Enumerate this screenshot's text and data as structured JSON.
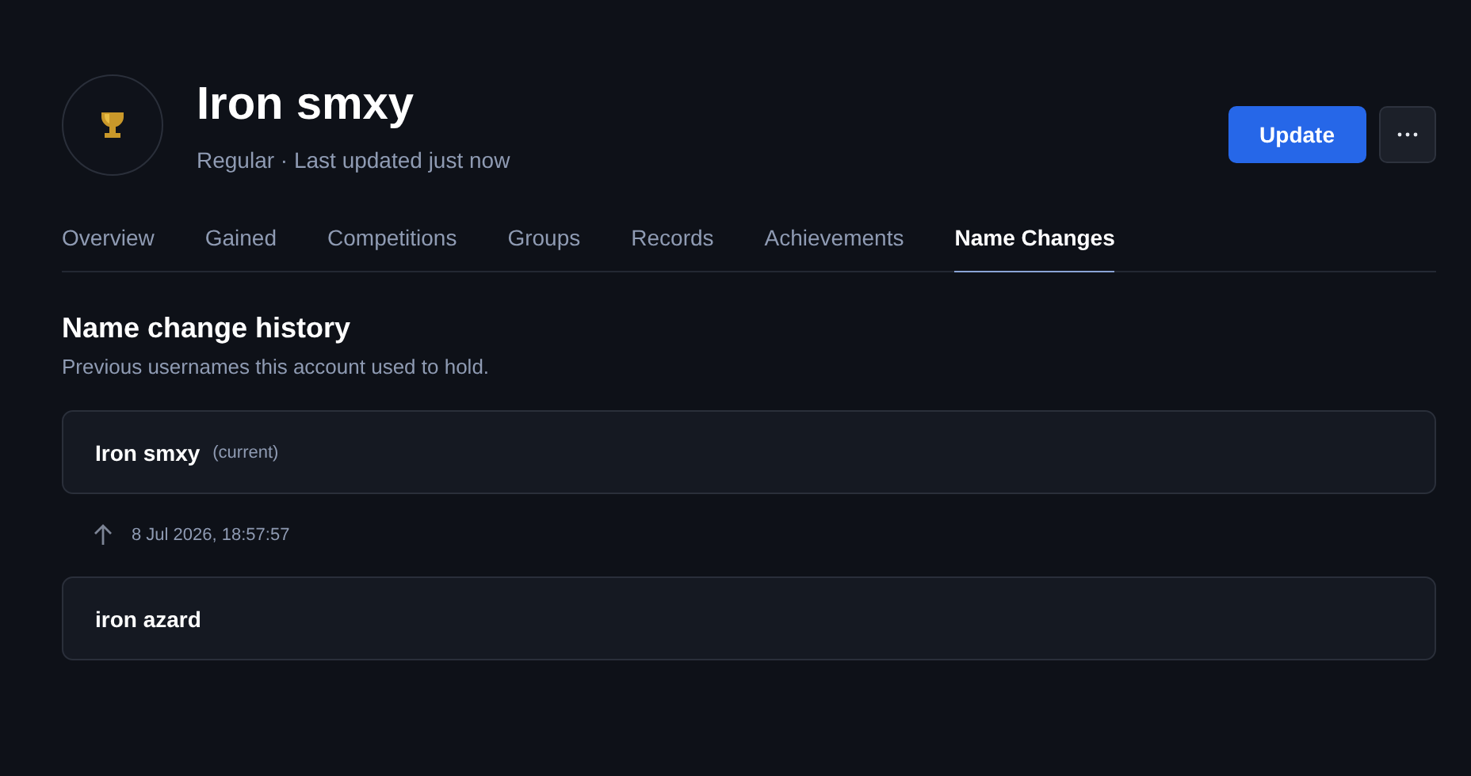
{
  "profile": {
    "name": "Iron smxy",
    "subtitle": "Regular · Last updated just now"
  },
  "actions": {
    "update": "Update"
  },
  "tabs": [
    {
      "label": "Overview",
      "selected": false
    },
    {
      "label": "Gained",
      "selected": false
    },
    {
      "label": "Competitions",
      "selected": false
    },
    {
      "label": "Groups",
      "selected": false
    },
    {
      "label": "Records",
      "selected": false
    },
    {
      "label": "Achievements",
      "selected": false
    },
    {
      "label": "Name Changes",
      "selected": true
    }
  ],
  "section": {
    "title": "Name change history",
    "description": "Previous usernames this account used to hold."
  },
  "history": [
    {
      "kind": "name",
      "name": "Iron smxy",
      "tag": "(current)"
    },
    {
      "kind": "change",
      "date": "8 Jul 2026, 18:57:57"
    },
    {
      "kind": "name",
      "name": "iron azard"
    }
  ]
}
